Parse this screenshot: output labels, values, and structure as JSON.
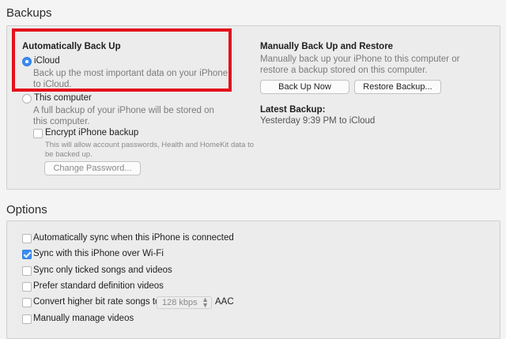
{
  "backups": {
    "title": "Backups",
    "auto": {
      "heading": "Automatically Back Up",
      "icloud_label": "iCloud",
      "icloud_desc": "Back up the most important data on your iPhone to iCloud.",
      "computer_label": "This computer",
      "computer_desc": "A full backup of your iPhone will be stored on this computer.",
      "encrypt_label": "Encrypt iPhone backup",
      "encrypt_desc": "This will allow account passwords, Health and HomeKit data to be backed up.",
      "change_password_label": "Change Password..."
    },
    "manual": {
      "heading": "Manually Back Up and Restore",
      "desc": "Manually back up your iPhone to this computer or restore a backup stored on this computer.",
      "backup_now_label": "Back Up Now",
      "restore_label": "Restore Backup...",
      "latest_heading": "Latest Backup:",
      "latest_value": "Yesterday 9:39 PM to iCloud"
    },
    "selected_option": "iCloud",
    "highlight_color": "#e3121b"
  },
  "options": {
    "title": "Options",
    "items": [
      {
        "label": "Automatically sync when this iPhone is connected",
        "checked": false
      },
      {
        "label": "Sync with this iPhone over Wi-Fi",
        "checked": true
      },
      {
        "label": "Sync only ticked songs and videos",
        "checked": false
      },
      {
        "label": "Prefer standard definition videos",
        "checked": false
      },
      {
        "label": "Convert higher bit rate songs to",
        "checked": false
      },
      {
        "label": "Manually manage videos",
        "checked": false
      }
    ],
    "bitrate_value": "128 kbps",
    "bitrate_format": "AAC"
  },
  "accent_color": "#3b8cf0"
}
